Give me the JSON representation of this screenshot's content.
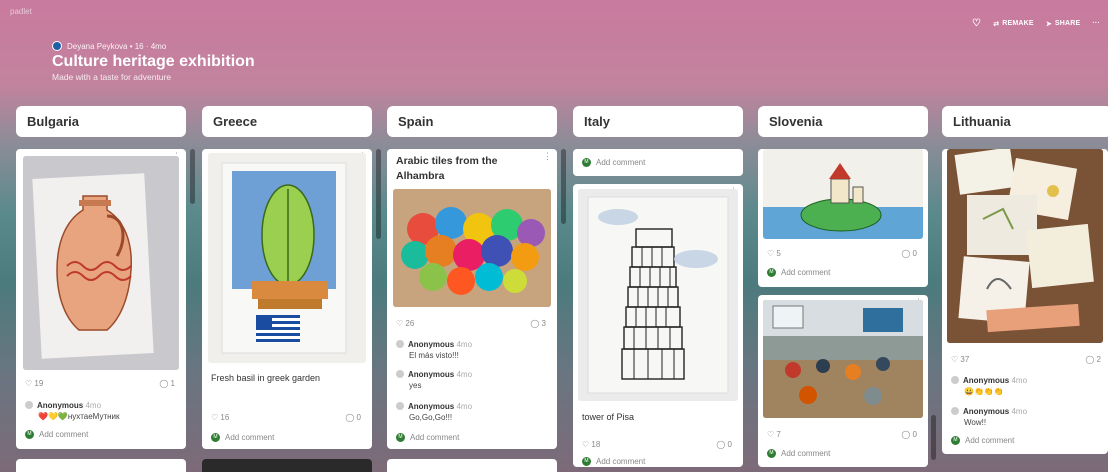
{
  "app": {
    "brand": "padlet"
  },
  "board": {
    "author": "Deyana Peykova",
    "likes": "16",
    "age": "4mo",
    "author_line": "Deyana Peykova  •  16  ·  4mo",
    "title": "Culture heritage exhibition",
    "subtitle": "Made with a taste for adventure"
  },
  "actions": {
    "remake": "REMAKE",
    "share": "SHARE",
    "more": "···"
  },
  "common": {
    "add_comment": "Add comment",
    "menu": "⋮"
  },
  "columns": {
    "bulgaria": {
      "title": "Bulgaria",
      "likes": "19",
      "comments": "1",
      "comment": {
        "author": "Anonymous",
        "when": "4mo",
        "text": "❤️💛💚нухтаеМутник"
      }
    },
    "greece": {
      "title": "Greece",
      "caption": "Fresh basil in greek garden",
      "likes": "16",
      "comments": "0"
    },
    "spain": {
      "title": "Spain",
      "post_title": "Arabic tiles from the Alhambra",
      "likes": "26",
      "comments": "3",
      "comments_list": [
        {
          "author": "Anonymous",
          "when": "4mo",
          "text": "El más visto!!!"
        },
        {
          "author": "Anonymous",
          "when": "4mo",
          "text": "yes"
        },
        {
          "author": "Anonymous",
          "when": "4mo",
          "text": "Go,Go,Go!!!"
        }
      ]
    },
    "italy": {
      "title": "Italy",
      "caption": "tower of Pisa",
      "likes": "18",
      "comments": "0"
    },
    "slovenia": {
      "title": "Slovenia",
      "likes1": "5",
      "comments1": "0",
      "likes2": "7",
      "comments2": "0"
    },
    "lithuania": {
      "title": "Lithuania",
      "likes": "37",
      "comments": "2",
      "comments_list": [
        {
          "author": "Anonymous",
          "when": "4mo",
          "text": "😀👏👏👏"
        },
        {
          "author": "Anonymous",
          "when": "4mo",
          "text": "Wow!!"
        }
      ]
    }
  }
}
